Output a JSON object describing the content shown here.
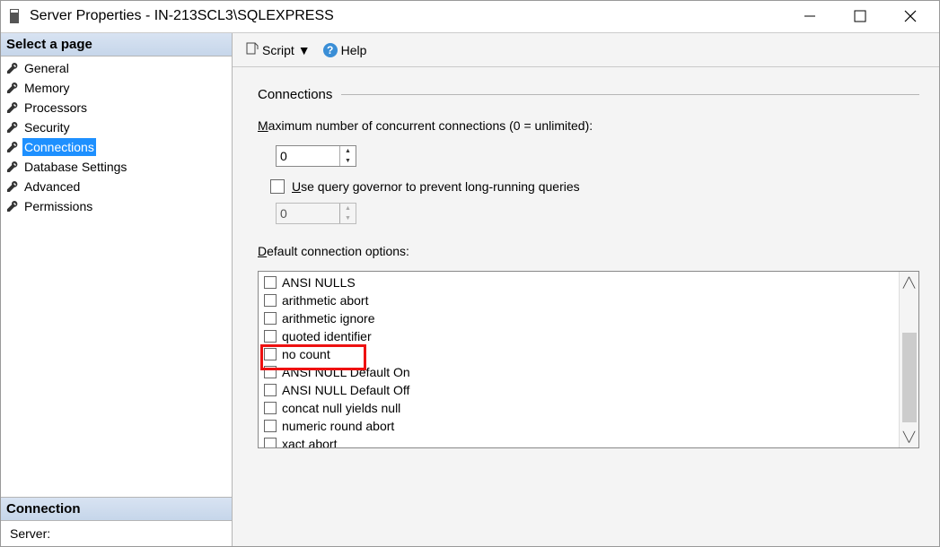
{
  "titlebar": {
    "title": "Server Properties - IN-213SCL3\\SQLEXPRESS"
  },
  "sidebar": {
    "select_page_header": "Select a page",
    "pages": [
      {
        "label": "General",
        "selected": false
      },
      {
        "label": "Memory",
        "selected": false
      },
      {
        "label": "Processors",
        "selected": false
      },
      {
        "label": "Security",
        "selected": false
      },
      {
        "label": "Connections",
        "selected": true
      },
      {
        "label": "Database Settings",
        "selected": false
      },
      {
        "label": "Advanced",
        "selected": false
      },
      {
        "label": "Permissions",
        "selected": false
      }
    ],
    "connection_header": "Connection",
    "server_label": "Server:"
  },
  "toolbar": {
    "script_label": "Script",
    "help_label": "Help"
  },
  "connections_panel": {
    "section_title": "Connections",
    "max_connections_label_pre": "M",
    "max_connections_label_rest": "aximum number of concurrent connections (0 = unlimited):",
    "max_connections_value": "0",
    "use_query_governor_checked": false,
    "use_query_governor_pre": "U",
    "use_query_governor_rest": "se query governor to prevent long-running queries",
    "governor_value": "0",
    "default_options_pre": "D",
    "default_options_rest": "efault connection options:",
    "options": [
      {
        "label": "ANSI NULLS",
        "highlight": false
      },
      {
        "label": "arithmetic abort",
        "highlight": false
      },
      {
        "label": "arithmetic ignore",
        "highlight": false
      },
      {
        "label": "quoted identifier",
        "highlight": false
      },
      {
        "label": "no count",
        "highlight": true
      },
      {
        "label": "ANSI NULL Default On",
        "highlight": false
      },
      {
        "label": "ANSI NULL Default Off",
        "highlight": false
      },
      {
        "label": "concat null yields null",
        "highlight": false
      },
      {
        "label": "numeric round abort",
        "highlight": false
      },
      {
        "label": "xact abort",
        "highlight": false
      }
    ]
  }
}
